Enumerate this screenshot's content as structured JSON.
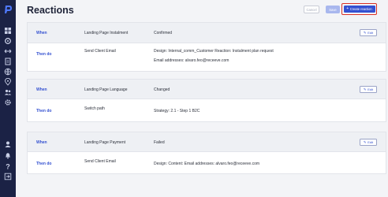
{
  "page": {
    "title": "Reactions"
  },
  "toolbar": {
    "cancel_label": "Cancel",
    "save_label": "Save",
    "create_label": "Create reaction",
    "create_icon": "plus-icon"
  },
  "sidebar": {
    "logo": "p-logo",
    "icons": [
      "dashboard-icon",
      "settings-cog-icon",
      "arrows-icon",
      "document-icon",
      "globe-icon",
      "location-icon",
      "users-icon",
      "gear-icon",
      "user-icon",
      "bell-icon",
      "help-icon",
      "logout-icon"
    ]
  },
  "reactions": [
    {
      "when_label": "When",
      "trigger": "Landing Page Instalment",
      "status": "Confirmed",
      "edit_label": "Edit",
      "then_label": "Then do",
      "action": "Send Client Email",
      "detail_line1": "Design:  Internal_comm_Customer Reaction: Instalment plan request",
      "detail_line2": "Email addresses:  alvaro.feo@receeve.com"
    },
    {
      "when_label": "When",
      "trigger": "Landing Page Language",
      "status": "Changed",
      "edit_label": "Edit",
      "then_label": "Then do",
      "action": "Switch path",
      "detail_line1": "Strategy:  2.1 - Step 1 B2C"
    },
    {
      "when_label": "When",
      "trigger": "Landing Page Payment",
      "status": "Failed",
      "edit_label": "Edit",
      "then_label": "Then do",
      "action": "Send Client Email",
      "detail_line1": "Design:       Content:       Email addresses:  alvaro.feo@receeve.com"
    }
  ]
}
